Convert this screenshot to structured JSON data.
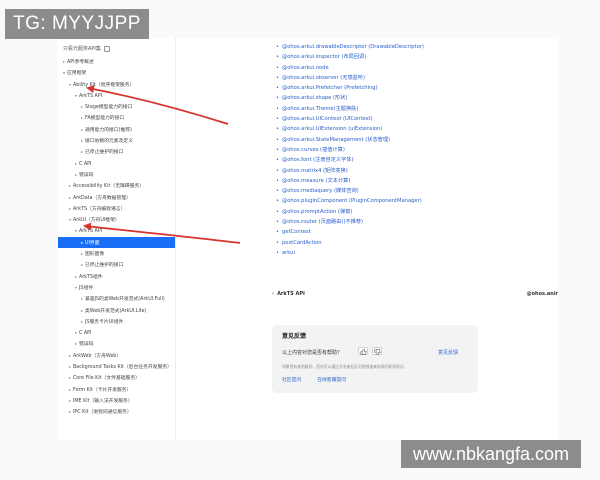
{
  "watermarks": {
    "top": "TG: MYYJJPP",
    "bottom": "www.nbkangfa.com"
  },
  "sidebar": {
    "checkbox_label": "只看元服务API集",
    "tree": [
      {
        "label": "API参考概述",
        "level": 0,
        "chev": "▸"
      },
      {
        "label": "应用框架",
        "level": 0,
        "chev": "▾"
      },
      {
        "label": "Ability Kit（程序框架服务）",
        "level": 1,
        "chev": "▾"
      },
      {
        "label": "ArkTS API",
        "level": 2,
        "chev": "▾"
      },
      {
        "label": "Stage模型能力的接口",
        "level": 3,
        "chev": "▸"
      },
      {
        "label": "FA模型能力的接口",
        "level": 3,
        "chev": "▸"
      },
      {
        "label": "通用能力的接口(推荐)",
        "level": 3,
        "chev": "▸"
      },
      {
        "label": "接口依赖的元素及定义",
        "level": 3,
        "chev": "▸"
      },
      {
        "label": "已停止维护的接口",
        "level": 3,
        "chev": "▸"
      },
      {
        "label": "C API",
        "level": 2,
        "chev": "▸"
      },
      {
        "label": "错误码",
        "level": 2,
        "chev": "▸"
      },
      {
        "label": "Accessibility Kit（无障碍服务）",
        "level": 1,
        "chev": "▸"
      },
      {
        "label": "ArkData（方舟数据管理）",
        "level": 1,
        "chev": "▸"
      },
      {
        "label": "ArkTS（方舟编程语言）",
        "level": 1,
        "chev": "▸"
      },
      {
        "label": "ArkUI（方舟UI框架）",
        "level": 1,
        "chev": "▾"
      },
      {
        "label": "ArkTS API",
        "level": 2,
        "chev": "▾"
      },
      {
        "label": "UI界面",
        "level": 3,
        "chev": "▸",
        "active": true
      },
      {
        "label": "图形图像",
        "level": 3,
        "chev": "▸"
      },
      {
        "label": "已停止维护的接口",
        "level": 3,
        "chev": "▸"
      },
      {
        "label": "ArkTS组件",
        "level": 2,
        "chev": "▸"
      },
      {
        "label": "JS组件",
        "level": 2,
        "chev": "▾"
      },
      {
        "label": "兼容JS的类Web开发范式(ArkUI.Full)",
        "level": 3,
        "chev": "▸"
      },
      {
        "label": "类Web开发范式(ArkUI.Lite)",
        "level": 3,
        "chev": "▸"
      },
      {
        "label": "JS服务卡片UI组件",
        "level": 3,
        "chev": "▸"
      },
      {
        "label": "C API",
        "level": 2,
        "chev": "▸"
      },
      {
        "label": "错误码",
        "level": 2,
        "chev": "▸"
      },
      {
        "label": "ArkWeb（方舟Web）",
        "level": 1,
        "chev": "▸"
      },
      {
        "label": "Background Tasks Kit（后台任务开发服务）",
        "level": 1,
        "chev": "▸"
      },
      {
        "label": "Core File Kit（文件基础服务）",
        "level": 1,
        "chev": "▸"
      },
      {
        "label": "Form Kit（卡片开发服务）",
        "level": 1,
        "chev": "▸"
      },
      {
        "label": "IME Kit（输入法开发服务）",
        "level": 1,
        "chev": "▸"
      },
      {
        "label": "IPC Kit（进程间通信服务）",
        "level": 1,
        "chev": "▸"
      }
    ]
  },
  "main": {
    "links": [
      "@ohos.arkui.drawableDescriptor (DrawableDescriptor)",
      "@ohos.arkui.inspector (布局回调)",
      "@ohos.arkui.node",
      "@ohos.arkui.observer (无感监听)",
      "@ohos.arkui.Prefetcher (Prefetching)",
      "@ohos.arkui.shape (形状)",
      "@ohos.arkui.Theme(主题换肤)",
      "@ohos.arkui.UIContext (UIContext)",
      "@ohos.arkui.UIExtension (uiExtension)",
      "@ohos.arkui.StateManagement (状态管理)",
      "@ohos.curves (插值计算)",
      "@ohos.font (注册自定义字体)",
      "@ohos.matrix4 (矩阵变换)",
      "@ohos.measure (文本计算)",
      "@ohos.mediaquery (媒体查询)",
      "@ohos.pluginComponent (PluginComponentManager)",
      "@ohos.promptAction (弹窗)",
      "@ohos.router (页面路由)(不推荐)",
      "getContext",
      "postCardAction",
      "arkui"
    ],
    "pager": {
      "prev_label": "ArkTS API",
      "next_label": "@ohos.anir"
    },
    "feedback": {
      "title": "意见反馈",
      "question": "以上内容对您是否有帮助？",
      "suggest_link": "意见反馈",
      "description": "如果您有其他疑问，您也可以通过开发者社区问答频道来和我们联系探讨。",
      "action_community": "社区提问",
      "action_ticket": "在线客服提问"
    }
  }
}
